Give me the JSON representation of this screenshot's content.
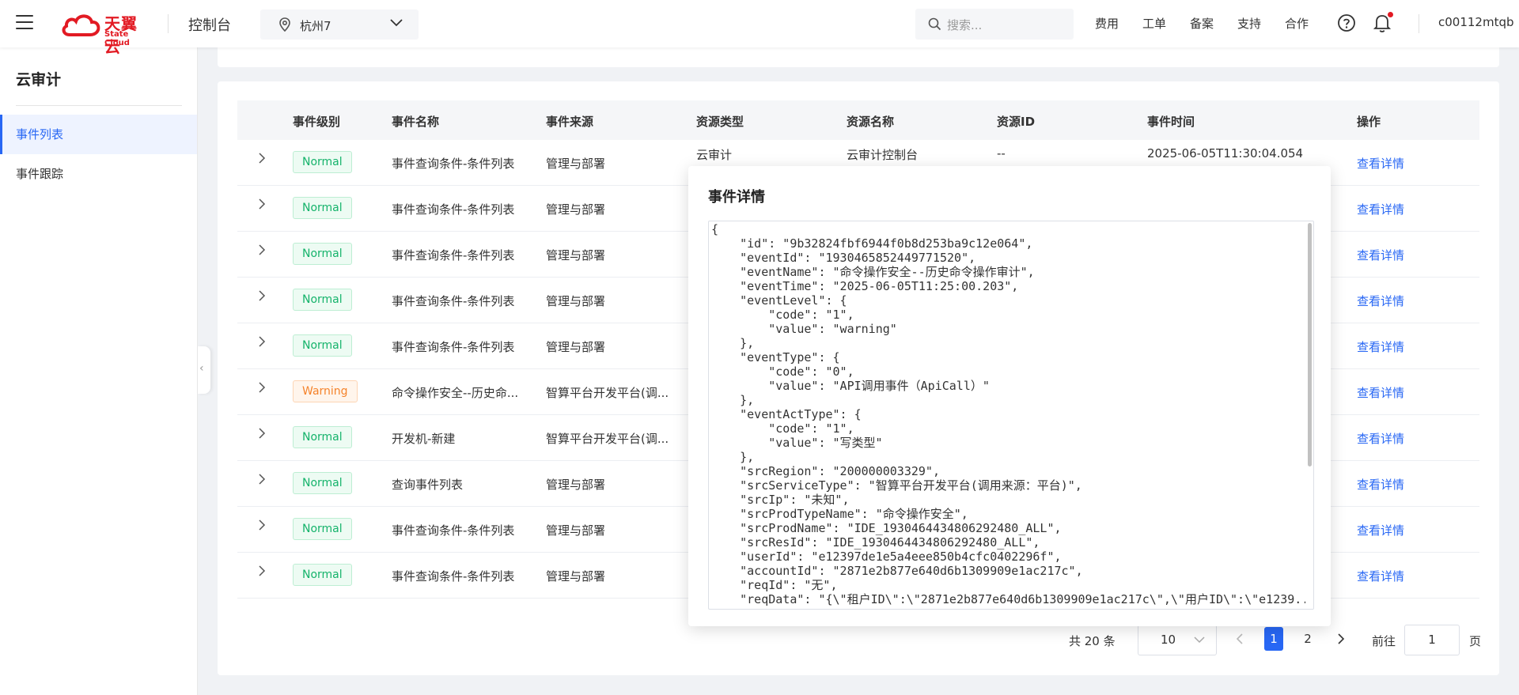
{
  "header": {
    "brand_cn": "天翼云",
    "brand_en": "State Cloud",
    "console": "控制台",
    "region": "杭州7",
    "search_placeholder": "搜索...",
    "nav": [
      "费用",
      "工单",
      "备案",
      "支持",
      "合作"
    ],
    "username": "c00112mtqb"
  },
  "sidebar": {
    "title": "云审计",
    "items": [
      {
        "label": "事件列表",
        "active": true
      },
      {
        "label": "事件跟踪",
        "active": false
      }
    ]
  },
  "table": {
    "columns": [
      "事件级别",
      "事件名称",
      "事件来源",
      "资源类型",
      "资源名称",
      "资源ID",
      "事件时间",
      "操作"
    ],
    "rows": [
      {
        "level": "Normal",
        "name": "事件查询条件-条件列表",
        "source": "管理与部署",
        "type": "云审计",
        "res_name": "云审计控制台",
        "res_id": "--",
        "time": "2025-06-05T11:30:04.054",
        "action": "查看详情"
      },
      {
        "level": "Normal",
        "name": "事件查询条件-条件列表",
        "source": "管理与部署",
        "action": "查看详情"
      },
      {
        "level": "Normal",
        "name": "事件查询条件-条件列表",
        "source": "管理与部署",
        "action": "查看详情"
      },
      {
        "level": "Normal",
        "name": "事件查询条件-条件列表",
        "source": "管理与部署",
        "action": "查看详情"
      },
      {
        "level": "Normal",
        "name": "事件查询条件-条件列表",
        "source": "管理与部署",
        "action": "查看详情"
      },
      {
        "level": "Warning",
        "name": "命令操作安全--历史命...",
        "source": "智算平台开发平台(调...",
        "action": "查看详情"
      },
      {
        "level": "Normal",
        "name": "开发机-新建",
        "source": "智算平台开发平台(调...",
        "action": "查看详情"
      },
      {
        "level": "Normal",
        "name": "查询事件列表",
        "source": "管理与部署",
        "action": "查看详情"
      },
      {
        "level": "Normal",
        "name": "事件查询条件-条件列表",
        "source": "管理与部署",
        "action": "查看详情"
      },
      {
        "level": "Normal",
        "name": "事件查询条件-条件列表",
        "source": "管理与部署",
        "action": "查看详情"
      }
    ]
  },
  "pagination": {
    "total": "共 20 条",
    "page_size": "10",
    "pages": [
      "1",
      "2"
    ],
    "current": "1",
    "goto_label": "前往",
    "goto_value": "1",
    "page_suffix": "页"
  },
  "popover": {
    "title": "事件详情",
    "json_lines": [
      "{",
      "    \"id\": \"9b32824fbf6944f0b8d253ba9c12e064\",",
      "    \"eventId\": \"1930465852449771520\",",
      "    \"eventName\": \"命令操作安全--历史命令操作审计\",",
      "    \"eventTime\": \"2025-06-05T11:25:00.203\",",
      "    \"eventLevel\": {",
      "        \"code\": \"1\",",
      "        \"value\": \"warning\"",
      "    },",
      "    \"eventType\": {",
      "        \"code\": \"0\",",
      "        \"value\": \"API调用事件（ApiCall）\"",
      "    },",
      "    \"eventActType\": {",
      "        \"code\": \"1\",",
      "        \"value\": \"写类型\"",
      "    },",
      "    \"srcRegion\": \"200000003329\",",
      "    \"srcServiceType\": \"智算平台开发平台(调用来源：平台)\",",
      "    \"srcIp\": \"未知\",",
      "    \"srcProdTypeName\": \"命令操作安全\",",
      "    \"srcProdName\": \"IDE_1930464434806292480_ALL\",",
      "    \"srcResId\": \"IDE_1930464434806292480_ALL\",",
      "    \"userId\": \"e12397de1e5a4eee850b4cfc0402296f\",",
      "    \"accountId\": \"2871e2b877e640d6b1309909e1ac217c\",",
      "    \"reqId\": \"无\",",
      "    \"reqData\": \"{\\\"租户ID\\\":\\\"2871e2b877e640d6b1309909e1ac217c\\\",\\\"用户ID\\\":\\\"e1239..."
    ]
  },
  "colors": {
    "accent": "#2867f4",
    "brand": "#e21a23",
    "normal": "#15b36b",
    "warning": "#f5832b"
  }
}
